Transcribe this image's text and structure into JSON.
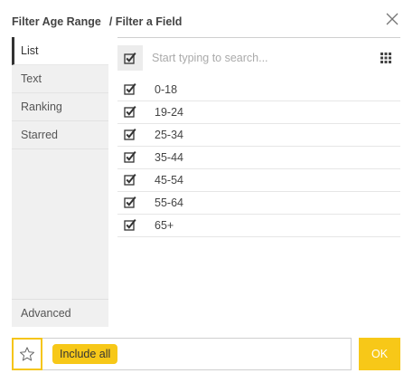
{
  "header": {
    "title": "Filter Age Range",
    "subtitle": "/ Filter a Field"
  },
  "sidebar": {
    "items": [
      {
        "label": "List",
        "active": true
      },
      {
        "label": "Text",
        "active": false
      },
      {
        "label": "Ranking",
        "active": false
      },
      {
        "label": "Starred",
        "active": false
      }
    ],
    "advanced_label": "Advanced"
  },
  "search": {
    "placeholder": "Start typing to search..."
  },
  "list": {
    "items": [
      {
        "label": "0-18",
        "checked": true
      },
      {
        "label": "19-24",
        "checked": true
      },
      {
        "label": "25-34",
        "checked": true
      },
      {
        "label": "35-44",
        "checked": true
      },
      {
        "label": "45-54",
        "checked": true
      },
      {
        "label": "55-64",
        "checked": true
      },
      {
        "label": "65+",
        "checked": true
      }
    ]
  },
  "footer": {
    "include_label": "Include all",
    "ok_label": "OK"
  },
  "colors": {
    "accent": "#f7c818",
    "sidebar_bg": "#f0f0f0"
  },
  "icons": [
    "close-icon",
    "checkbox-icon",
    "grid-icon",
    "star-icon"
  ]
}
